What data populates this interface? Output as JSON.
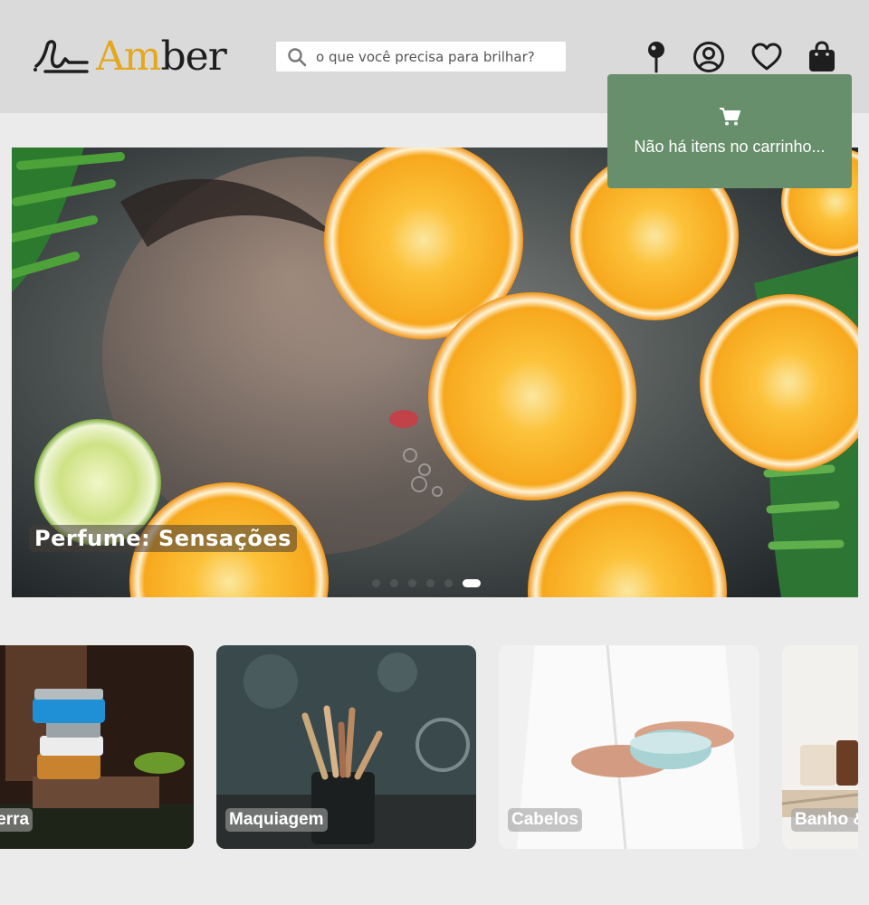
{
  "brand": {
    "name_accent": "Am",
    "name_rest": "ber",
    "accent_color": "#e3a81c"
  },
  "search": {
    "placeholder": "o que você precisa para brilhar?",
    "icon": "search-icon"
  },
  "header_icons": [
    "location-pin-icon",
    "user-account-icon",
    "heart-icon",
    "shopping-bag-icon"
  ],
  "cart_popup": {
    "message": "Não há itens no carrinho...",
    "icon": "cart-icon",
    "background": "#688f6b"
  },
  "hero": {
    "caption": "Perfume: Sensações",
    "slides": 6,
    "active_slide": 6
  },
  "categories": [
    {
      "label": "Terra"
    },
    {
      "label": "Maquiagem"
    },
    {
      "label": "Cabelos"
    },
    {
      "label": "Banho &"
    }
  ]
}
